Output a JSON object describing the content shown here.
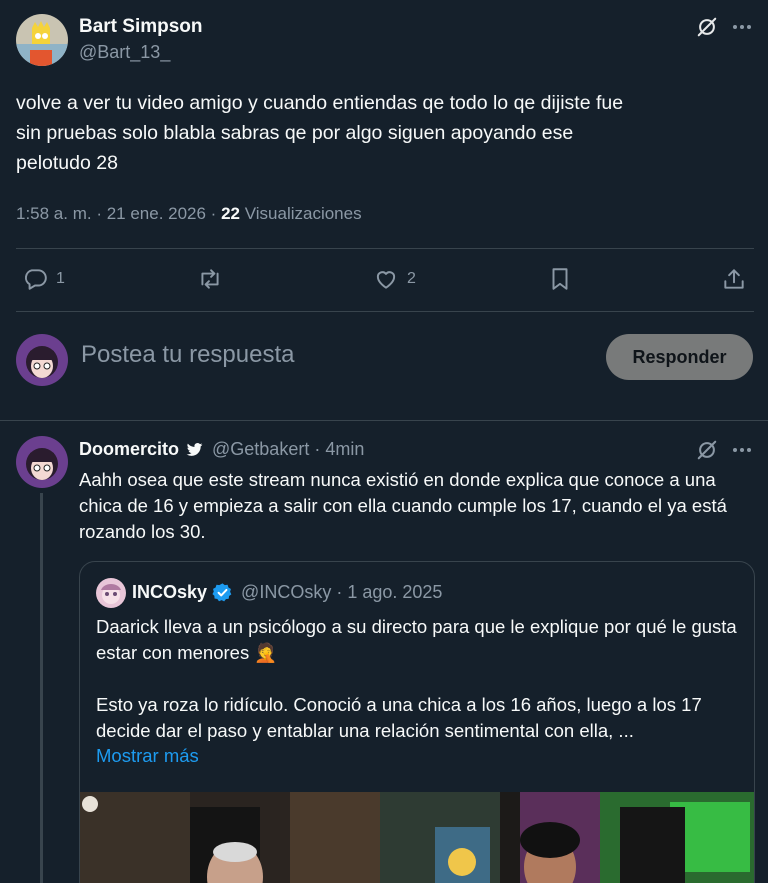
{
  "main_tweet": {
    "author_name": "Bart Simpson",
    "author_handle": "@Bart_13_",
    "text": "volve a ver tu video amigo y cuando entiendas qe todo lo qe dijiste fue\nsin pruebas solo blabla sabras qe por algo siguen apoyando ese\npelotudo 28",
    "time": "1:58 a. m. · 21 ene. 2026 · ",
    "views_count": "22",
    "views_label": " Visualizaciones",
    "replies": "1",
    "likes": "2"
  },
  "composer": {
    "placeholder": "Postea tu respuesta",
    "button_label": "Responder"
  },
  "reply": {
    "author_name": "Doomercito",
    "author_handle": "@Getbakert · 4min",
    "text": "Aahh osea que este stream nunca existió en donde explica que conoce a una chica de 16 y empieza a salir con ella cuando cumple los 17,  cuando el ya está rozando los 30.",
    "quote": {
      "author_name": "INCOsky",
      "author_handle": "@INCOsky · 1 ago. 2025",
      "text": "Daarick lleva a un psicólogo a su directo para que le explique por qué le gusta estar con menores 🤦\n\nEsto ya roza lo ridículo. Conoció a una chica a los 16 años, luego a los 17 decide dar el paso y entablar una relación sentimental con ella, ...",
      "show_more": "Mostrar más"
    }
  },
  "colors": {
    "background": "#15202b",
    "text_primary": "#f7f9f9",
    "text_secondary": "#8b98a5",
    "divider": "#38444d",
    "link": "#1d9bf0",
    "verified": "#1d9bf0",
    "button_bg": "#787a7a"
  },
  "icons": [
    "grok-icon",
    "more-icon",
    "reply-icon",
    "retweet-icon",
    "like-icon",
    "bookmark-icon",
    "share-icon",
    "bird-badge-icon",
    "verified-badge-icon"
  ]
}
